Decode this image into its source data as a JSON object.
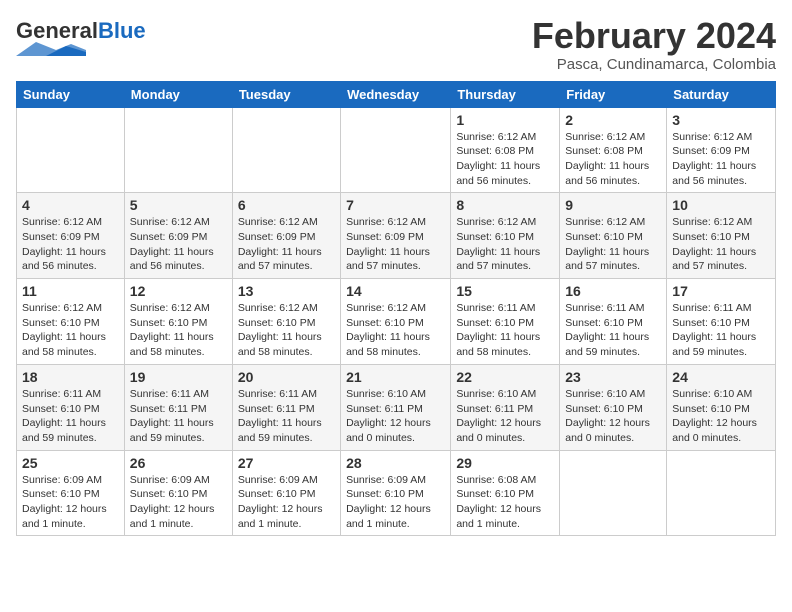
{
  "header": {
    "logo_general": "General",
    "logo_blue": "Blue",
    "title": "February 2024",
    "subtitle": "Pasca, Cundinamarca, Colombia"
  },
  "weekdays": [
    "Sunday",
    "Monday",
    "Tuesday",
    "Wednesday",
    "Thursday",
    "Friday",
    "Saturday"
  ],
  "weeks": [
    [
      {
        "day": "",
        "info": ""
      },
      {
        "day": "",
        "info": ""
      },
      {
        "day": "",
        "info": ""
      },
      {
        "day": "",
        "info": ""
      },
      {
        "day": "1",
        "info": "Sunrise: 6:12 AM\nSunset: 6:08 PM\nDaylight: 11 hours and 56 minutes."
      },
      {
        "day": "2",
        "info": "Sunrise: 6:12 AM\nSunset: 6:08 PM\nDaylight: 11 hours and 56 minutes."
      },
      {
        "day": "3",
        "info": "Sunrise: 6:12 AM\nSunset: 6:09 PM\nDaylight: 11 hours and 56 minutes."
      }
    ],
    [
      {
        "day": "4",
        "info": "Sunrise: 6:12 AM\nSunset: 6:09 PM\nDaylight: 11 hours and 56 minutes."
      },
      {
        "day": "5",
        "info": "Sunrise: 6:12 AM\nSunset: 6:09 PM\nDaylight: 11 hours and 56 minutes."
      },
      {
        "day": "6",
        "info": "Sunrise: 6:12 AM\nSunset: 6:09 PM\nDaylight: 11 hours and 57 minutes."
      },
      {
        "day": "7",
        "info": "Sunrise: 6:12 AM\nSunset: 6:09 PM\nDaylight: 11 hours and 57 minutes."
      },
      {
        "day": "8",
        "info": "Sunrise: 6:12 AM\nSunset: 6:10 PM\nDaylight: 11 hours and 57 minutes."
      },
      {
        "day": "9",
        "info": "Sunrise: 6:12 AM\nSunset: 6:10 PM\nDaylight: 11 hours and 57 minutes."
      },
      {
        "day": "10",
        "info": "Sunrise: 6:12 AM\nSunset: 6:10 PM\nDaylight: 11 hours and 57 minutes."
      }
    ],
    [
      {
        "day": "11",
        "info": "Sunrise: 6:12 AM\nSunset: 6:10 PM\nDaylight: 11 hours and 58 minutes."
      },
      {
        "day": "12",
        "info": "Sunrise: 6:12 AM\nSunset: 6:10 PM\nDaylight: 11 hours and 58 minutes."
      },
      {
        "day": "13",
        "info": "Sunrise: 6:12 AM\nSunset: 6:10 PM\nDaylight: 11 hours and 58 minutes."
      },
      {
        "day": "14",
        "info": "Sunrise: 6:12 AM\nSunset: 6:10 PM\nDaylight: 11 hours and 58 minutes."
      },
      {
        "day": "15",
        "info": "Sunrise: 6:11 AM\nSunset: 6:10 PM\nDaylight: 11 hours and 58 minutes."
      },
      {
        "day": "16",
        "info": "Sunrise: 6:11 AM\nSunset: 6:10 PM\nDaylight: 11 hours and 59 minutes."
      },
      {
        "day": "17",
        "info": "Sunrise: 6:11 AM\nSunset: 6:10 PM\nDaylight: 11 hours and 59 minutes."
      }
    ],
    [
      {
        "day": "18",
        "info": "Sunrise: 6:11 AM\nSunset: 6:10 PM\nDaylight: 11 hours and 59 minutes."
      },
      {
        "day": "19",
        "info": "Sunrise: 6:11 AM\nSunset: 6:11 PM\nDaylight: 11 hours and 59 minutes."
      },
      {
        "day": "20",
        "info": "Sunrise: 6:11 AM\nSunset: 6:11 PM\nDaylight: 11 hours and 59 minutes."
      },
      {
        "day": "21",
        "info": "Sunrise: 6:10 AM\nSunset: 6:11 PM\nDaylight: 12 hours and 0 minutes."
      },
      {
        "day": "22",
        "info": "Sunrise: 6:10 AM\nSunset: 6:11 PM\nDaylight: 12 hours and 0 minutes."
      },
      {
        "day": "23",
        "info": "Sunrise: 6:10 AM\nSunset: 6:10 PM\nDaylight: 12 hours and 0 minutes."
      },
      {
        "day": "24",
        "info": "Sunrise: 6:10 AM\nSunset: 6:10 PM\nDaylight: 12 hours and 0 minutes."
      }
    ],
    [
      {
        "day": "25",
        "info": "Sunrise: 6:09 AM\nSunset: 6:10 PM\nDaylight: 12 hours and 1 minute."
      },
      {
        "day": "26",
        "info": "Sunrise: 6:09 AM\nSunset: 6:10 PM\nDaylight: 12 hours and 1 minute."
      },
      {
        "day": "27",
        "info": "Sunrise: 6:09 AM\nSunset: 6:10 PM\nDaylight: 12 hours and 1 minute."
      },
      {
        "day": "28",
        "info": "Sunrise: 6:09 AM\nSunset: 6:10 PM\nDaylight: 12 hours and 1 minute."
      },
      {
        "day": "29",
        "info": "Sunrise: 6:08 AM\nSunset: 6:10 PM\nDaylight: 12 hours and 1 minute."
      },
      {
        "day": "",
        "info": ""
      },
      {
        "day": "",
        "info": ""
      }
    ]
  ]
}
